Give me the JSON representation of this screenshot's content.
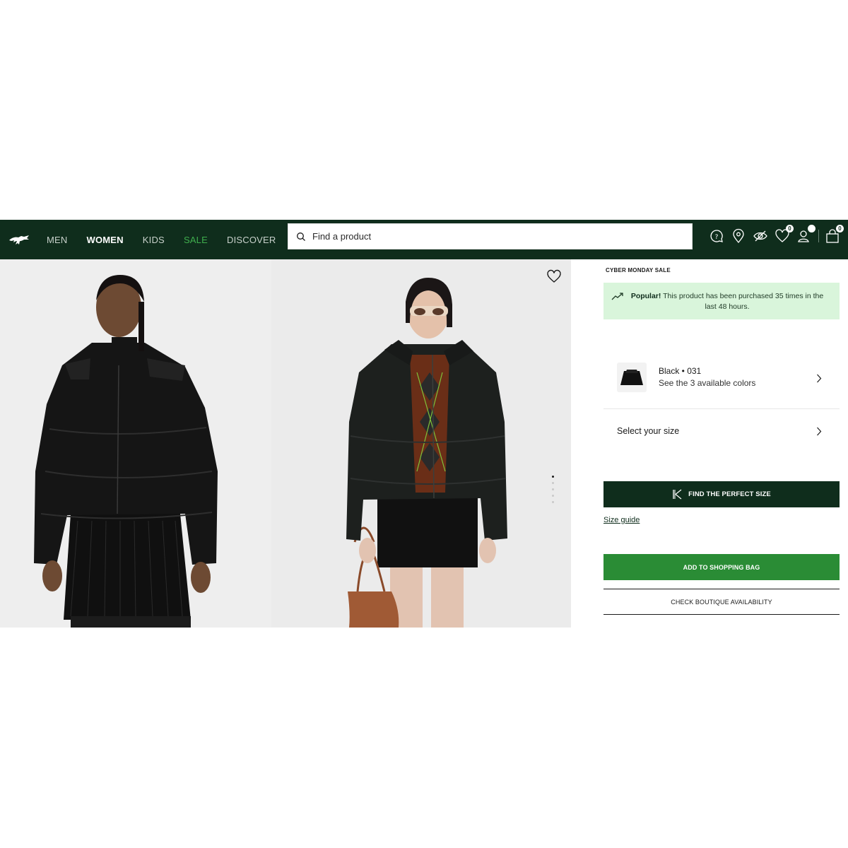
{
  "header": {
    "logo": "crocodile-logo",
    "nav": [
      {
        "label": "MEN",
        "state": "default"
      },
      {
        "label": "WOMEN",
        "state": "active"
      },
      {
        "label": "KIDS",
        "state": "default"
      },
      {
        "label": "SALE",
        "state": "sale"
      },
      {
        "label": "DISCOVER",
        "state": "default"
      }
    ],
    "search": {
      "placeholder": "Find a product",
      "icon": "search-icon"
    },
    "icons": [
      {
        "name": "help-icon"
      },
      {
        "name": "store-locator-icon"
      },
      {
        "name": "hide-icon"
      },
      {
        "name": "wishlist-icon",
        "badge": "0"
      },
      {
        "name": "account-icon",
        "badge": ""
      },
      {
        "name": "shopping-bag-icon",
        "badge": "0"
      }
    ]
  },
  "gallery": {
    "images": [
      "model-front-black-puffer-jacket",
      "model-black-puffer-jacket-with-sunglasses"
    ],
    "slide_count": 5,
    "active_slide": 1
  },
  "product": {
    "sale_tag": "CYBER MONDAY SALE",
    "popular": {
      "strong": "Popular!",
      "text": " This product has been purchased 35 times in the last 48 hours."
    },
    "color": {
      "name": "Black • 031",
      "available": "See the 3 available colors"
    },
    "size_label": "Select your size",
    "find_size_button": "FIND THE PERFECT SIZE",
    "size_guide": "Size guide",
    "add_to_bag_button": "ADD TO SHOPPING BAG",
    "boutique_button": "CHECK BOUTIQUE AVAILABILITY"
  },
  "colors": {
    "header_bg": "#0f2d1c",
    "sale": "#3fae4d",
    "add_button": "#2a8c35",
    "popular_bg": "#d9f5db"
  }
}
